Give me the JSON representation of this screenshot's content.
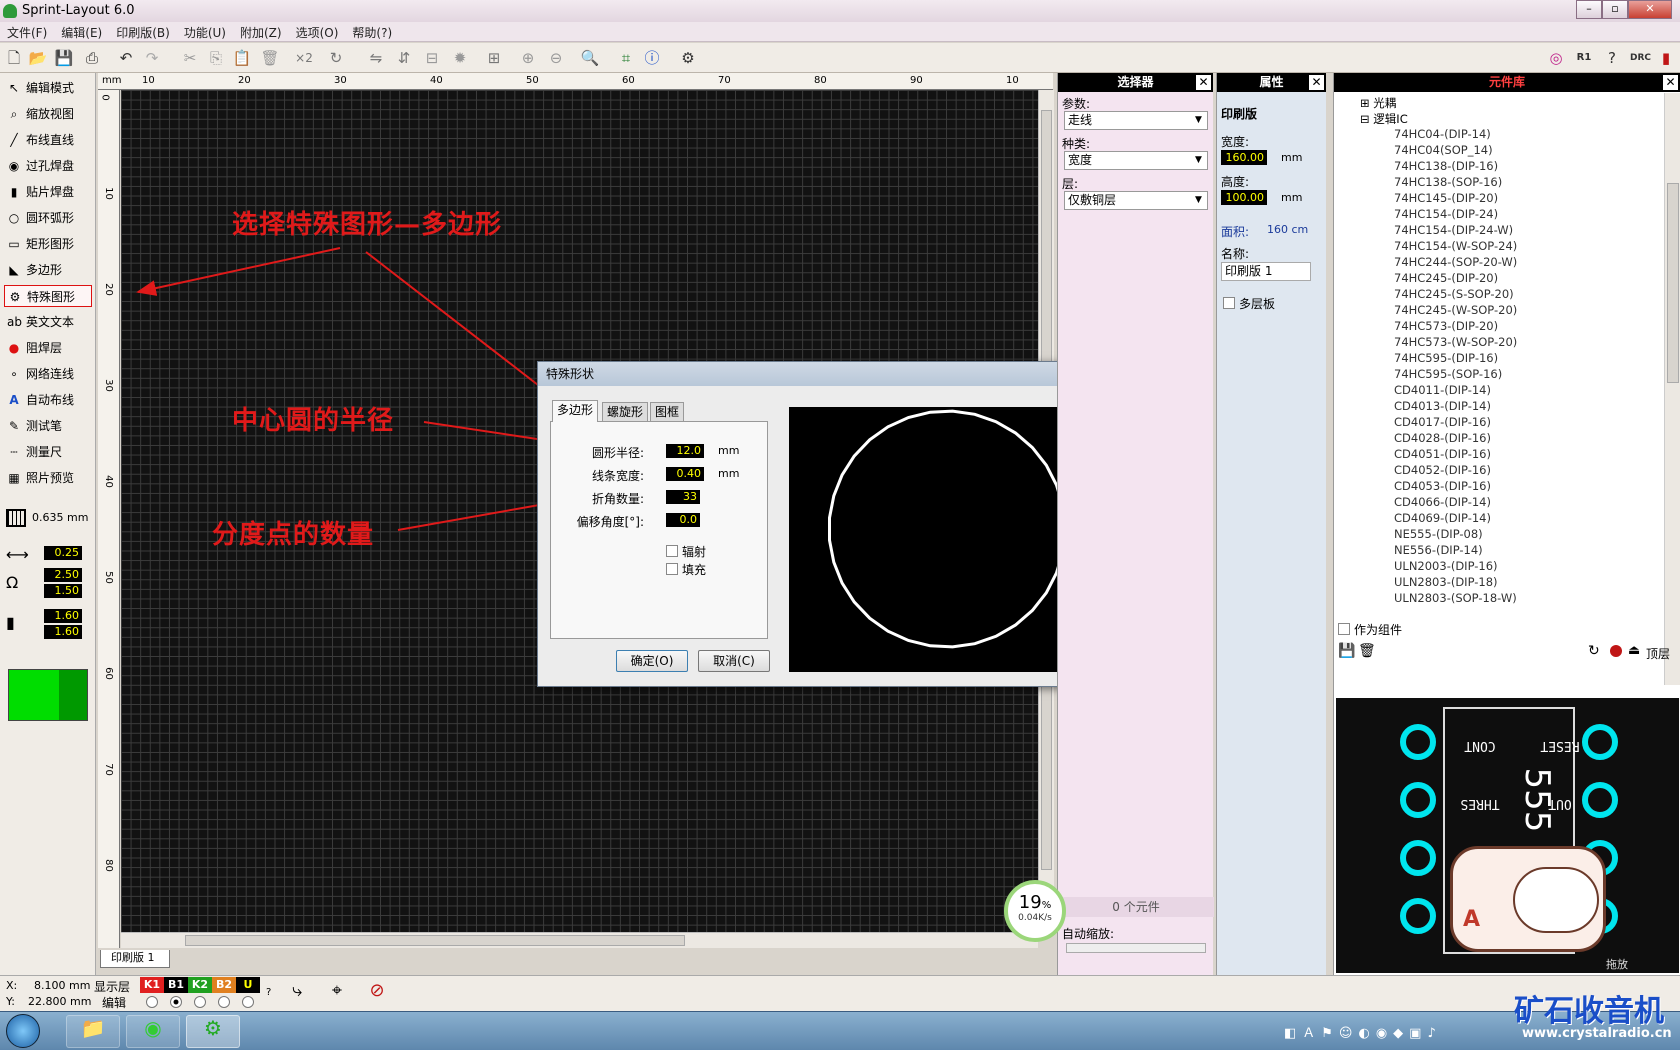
{
  "window": {
    "title": "Sprint-Layout 6.0"
  },
  "menu": [
    "文件(F)",
    "编辑(E)",
    "印刷版(B)",
    "功能(U)",
    "附加(Z)",
    "选项(O)",
    "帮助(?)"
  ],
  "tools": [
    {
      "label": "编辑模式",
      "icon": "cursor-icon"
    },
    {
      "label": "缩放视图",
      "icon": "zoom-icon"
    },
    {
      "label": "布线直线",
      "icon": "track-icon"
    },
    {
      "label": "过孔焊盘",
      "icon": "via-pad-icon"
    },
    {
      "label": "贴片焊盘",
      "icon": "smd-pad-icon"
    },
    {
      "label": "圆环弧形",
      "icon": "circle-icon"
    },
    {
      "label": "矩形图形",
      "icon": "rectangle-icon"
    },
    {
      "label": "多边形",
      "icon": "polygon-icon"
    },
    {
      "label": "特殊图形",
      "icon": "special-shape-icon"
    },
    {
      "label": "英文文本",
      "icon": "text-icon"
    },
    {
      "label": "阻焊层",
      "icon": "solder-mask-icon"
    },
    {
      "label": "网络连线",
      "icon": "netlist-icon"
    },
    {
      "label": "自动布线",
      "icon": "autoroute-icon"
    },
    {
      "label": "测试笔",
      "icon": "probe-icon"
    },
    {
      "label": "测量尺",
      "icon": "ruler-icon"
    },
    {
      "label": "照片预览",
      "icon": "photo-icon"
    }
  ],
  "grid": {
    "size": "0.635 mm"
  },
  "params": {
    "track_width": "0.25",
    "pad_outer": "2.50",
    "pad_inner": "1.50",
    "smd_w": "1.60",
    "smd_h": "1.60"
  },
  "ruler": {
    "unit": "mm",
    "h_ticks": [
      "10",
      "20",
      "30",
      "40",
      "50",
      "60",
      "70",
      "80",
      "90",
      "10"
    ],
    "v_ticks": [
      "0",
      "10",
      "20",
      "30",
      "40",
      "50",
      "60",
      "70",
      "80"
    ]
  },
  "board_tab": "印刷版 1",
  "annotations": {
    "a1": "选择特殊图形—多边形",
    "a2": "中心圆的半径",
    "a3": "分度点的数量"
  },
  "selector": {
    "title": "选择器",
    "param_label": "参数:",
    "param_value": "走线",
    "kind_label": "种类:",
    "kind_value": "宽度",
    "layer_label": "层:",
    "layer_value": "仅敷铜层",
    "count": "0 个元件",
    "autozoom": "自动缩放:"
  },
  "properties": {
    "title": "属性",
    "section": "印刷版",
    "width_label": "宽度:",
    "width": "160.00",
    "unit": "mm",
    "height_label": "高度:",
    "height": "100.00",
    "area_label": "面积:",
    "area": "160 cm",
    "name_label": "名称:",
    "name": "印刷版 1",
    "multilayer": "多层板"
  },
  "library": {
    "title": "元件库",
    "groups": [
      "光耦",
      "逻辑IC"
    ],
    "items": [
      "74HC04-(DIP-14)",
      "74HC04(SOP_14)",
      "74HC138-(DIP-16)",
      "74HC138-(SOP-16)",
      "74HC145-(DIP-20)",
      "74HC154-(DIP-24)",
      "74HC154-(DIP-24-W)",
      "74HC154-(W-SOP-24)",
      "74HC244-(SOP-20-W)",
      "74HC245-(DIP-20)",
      "74HC245-(S-SOP-20)",
      "74HC245-(W-SOP-20)",
      "74HC573-(DIP-20)",
      "74HC573-(W-SOP-20)",
      "74HC595-(DIP-16)",
      "74HC595-(SOP-16)",
      "CD4011-(DIP-14)",
      "CD4013-(DIP-14)",
      "CD4017-(DIP-16)",
      "CD4028-(DIP-16)",
      "CD4051-(DIP-16)",
      "CD4052-(DIP-16)",
      "CD4053-(DIP-16)",
      "CD4066-(DIP-14)",
      "CD4069-(DIP-14)",
      "NE555-(DIP-08)",
      "NE556-(DIP-14)",
      "ULN2003-(DIP-16)",
      "ULN2803-(DIP-18)",
      "ULN2803-(SOP-18-W)"
    ],
    "as_component": "作为组件",
    "layer": "顶层",
    "preview_labels": {
      "reset": "RESET",
      "cont": "CONT",
      "thres": "THRES",
      "out": "OUT",
      "chip": "555"
    },
    "drag": "拖放"
  },
  "dialog": {
    "title": "特殊形状",
    "tabs": [
      "多边形",
      "螺旋形",
      "图框"
    ],
    "radius_label": "圆形半径:",
    "radius": "12.0",
    "line_label": "线条宽度:",
    "line": "0.40",
    "corners_label": "折角数量:",
    "corners": "33",
    "offset_label": "偏移角度[°]:",
    "offset": "0.0",
    "unit": "mm",
    "radial": "辐射",
    "fill": "填充",
    "ok": "确定(O)",
    "cancel": "取消(C)",
    "help": "?"
  },
  "status": {
    "x_label": "X:",
    "x": "8.100 mm",
    "y_label": "Y:",
    "y": "22.800 mm",
    "show_layer": "显示层",
    "edit": "编辑",
    "layers": [
      "K1",
      "B1",
      "K2",
      "B2",
      "U"
    ],
    "layer_colors": [
      "#e02020",
      "#000000",
      "#20a020",
      "#e08020",
      "#000000"
    ]
  },
  "netspeed": {
    "percent": "19",
    "unit": "%",
    "speed": "0.04K/s"
  },
  "watermark": {
    "text": "矿石收音机",
    "url": "www.crystalradio.cn"
  }
}
